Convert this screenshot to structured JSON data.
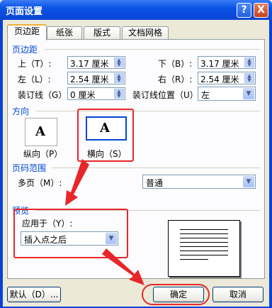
{
  "window": {
    "title": "页面设置",
    "help_glyph": "?",
    "close_glyph": "X"
  },
  "tabs": [
    {
      "label": "页边距",
      "active": true
    },
    {
      "label": "纸张",
      "active": false
    },
    {
      "label": "版式",
      "active": false
    },
    {
      "label": "文档网格",
      "active": false
    }
  ],
  "margins": {
    "section": "页边距",
    "top": {
      "label": "上（T）:",
      "value": "3.17 厘米"
    },
    "bottom": {
      "label": "下（B）:",
      "value": "3.17 厘米"
    },
    "left": {
      "label": "左（L）:",
      "value": "2.54 厘米"
    },
    "right": {
      "label": "右（R）:",
      "value": "2.54 厘米"
    },
    "gutter": {
      "label": "装订线（G）:",
      "value": "0 厘米"
    },
    "gutter_pos": {
      "label": "装订线位置（U）:",
      "value": "左"
    }
  },
  "orientation": {
    "section": "方向",
    "portrait": "纵向（P）",
    "landscape": "横向（S）",
    "selected": "landscape",
    "glyph": "A"
  },
  "pages": {
    "section": "页码范围",
    "label": "多页（M）:",
    "value": "普通"
  },
  "preview": {
    "section": "预览",
    "apply_label": "应用于（Y）:",
    "apply_value": "插入点之后"
  },
  "buttons": {
    "default": "默认（D）...",
    "ok": "确定",
    "cancel": "取消"
  },
  "colors": {
    "section_text": "#0046d5",
    "annotation": "#e8262a",
    "titlebar": "#0a53e4"
  }
}
